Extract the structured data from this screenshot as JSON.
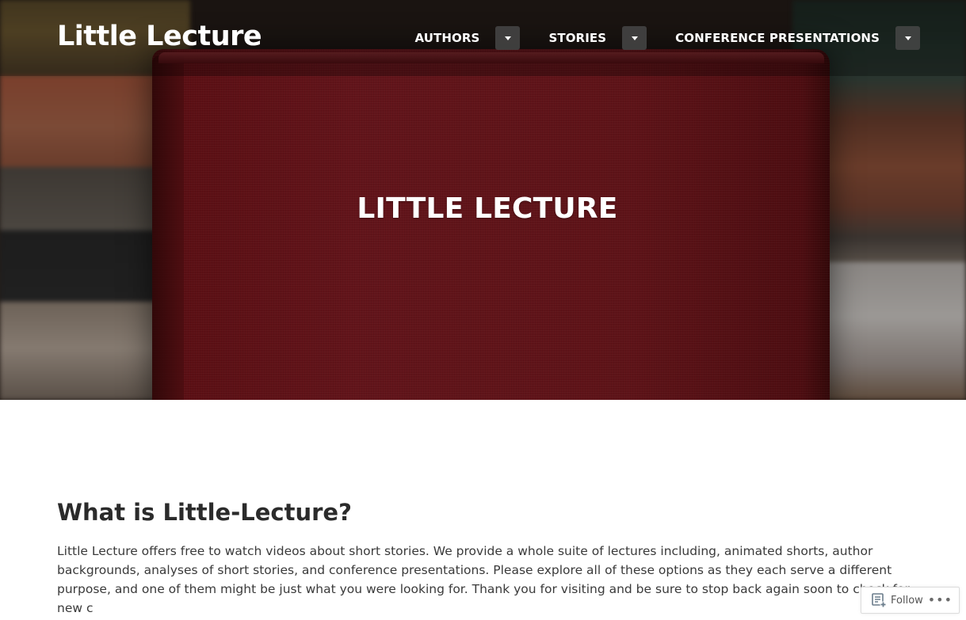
{
  "site": {
    "title": "Little Lecture"
  },
  "nav": {
    "items": [
      {
        "label": "AUTHORS"
      },
      {
        "label": "STORIES"
      },
      {
        "label": "CONFERENCE PRESENTATIONS"
      }
    ]
  },
  "hero": {
    "heading": "LITTLE LECTURE"
  },
  "main": {
    "heading": "What is Little-Lecture?",
    "body": "Little Lecture offers free to watch videos about short stories. We provide a whole suite of lectures including, animated shorts, author backgrounds, analyses of short stories, and conference presentations. Please explore all of these options as they each serve a different purpose, and one of them might be just what you were looking for. Thank you for visiting and be sure to stop back again soon to check for new c"
  },
  "follow_bar": {
    "follow_label": "Follow",
    "more_label": "•••"
  },
  "icons": {
    "nav_toggle": "chevron-down-icon",
    "follow": "reader-follow-icon",
    "more": "ellipsis-icon"
  }
}
